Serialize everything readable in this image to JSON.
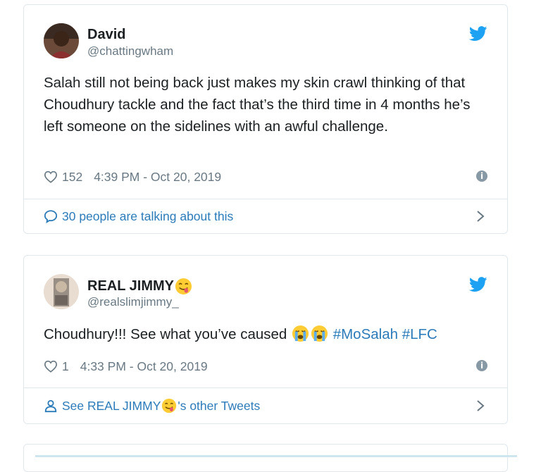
{
  "tweets": [
    {
      "author_name": "David",
      "author_handle": "@chattingwham",
      "text": "Salah still not being back just makes my skin crawl thinking of that Choudhury tackle and the fact that’s the third time in 4 months he’s left someone on the sidelines with an awful challenge.",
      "likes": "152",
      "timestamp": "4:39 PM - Oct 20, 2019",
      "footer_text": "30 people are talking about this",
      "footer_icon": "speech-bubble-icon"
    },
    {
      "author_name": "REAL JIMMY",
      "author_name_emoji": "savoring-food-face-emoji",
      "author_handle": "@realslimjimmy_",
      "text_plain": "Choudhury!!! See what you’ve caused",
      "text_emojis": [
        "loudly-crying-face-emoji",
        "loudly-crying-face-emoji"
      ],
      "hashtags": [
        "#MoSalah",
        "#LFC"
      ],
      "likes": "1",
      "timestamp": "4:33 PM - Oct 20, 2019",
      "footer_text_prefix": "See REAL JIMMY",
      "footer_text_suffix": "'s other Tweets",
      "footer_icon": "person-icon"
    }
  ],
  "colors": {
    "link": "#2b7bb9",
    "muted": "#697882",
    "border": "#e1e8ed",
    "twitter_blue": "#1da1f2"
  }
}
